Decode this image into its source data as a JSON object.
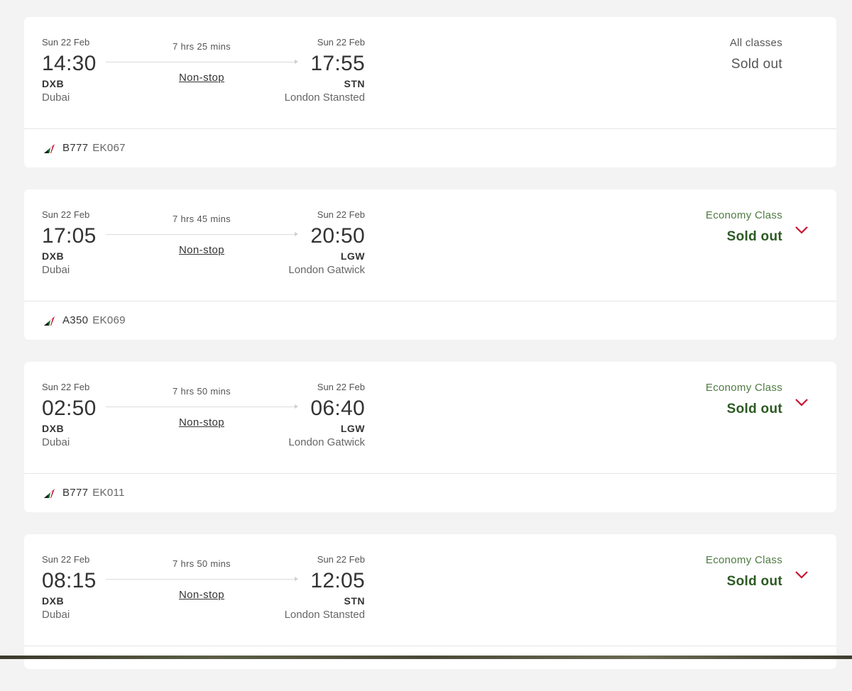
{
  "flights": [
    {
      "departure": {
        "date": "Sun 22 Feb",
        "time": "14:30",
        "code": "DXB",
        "city": "Dubai"
      },
      "duration": "7 hrs 25 mins",
      "stops": "Non-stop",
      "arrival": {
        "date": "Sun 22 Feb",
        "time": "17:55",
        "code": "STN",
        "city": "London Stansted"
      },
      "fare": {
        "class": "All classes",
        "status": "Sold out"
      },
      "aircraft": "B777",
      "flight_number": "EK067"
    },
    {
      "departure": {
        "date": "Sun 22 Feb",
        "time": "17:05",
        "code": "DXB",
        "city": "Dubai"
      },
      "duration": "7 hrs 45 mins",
      "stops": "Non-stop",
      "arrival": {
        "date": "Sun 22 Feb",
        "time": "20:50",
        "code": "LGW",
        "city": "London Gatwick"
      },
      "fare": {
        "class": "Economy Class",
        "status": "Sold out"
      },
      "aircraft": "A350",
      "flight_number": "EK069"
    },
    {
      "departure": {
        "date": "Sun 22 Feb",
        "time": "02:50",
        "code": "DXB",
        "city": "Dubai"
      },
      "duration": "7 hrs 50 mins",
      "stops": "Non-stop",
      "arrival": {
        "date": "Sun 22 Feb",
        "time": "06:40",
        "code": "LGW",
        "city": "London Gatwick"
      },
      "fare": {
        "class": "Economy Class",
        "status": "Sold out"
      },
      "aircraft": "B777",
      "flight_number": "EK011"
    },
    {
      "departure": {
        "date": "Sun 22 Feb",
        "time": "08:15",
        "code": "DXB",
        "city": "Dubai"
      },
      "duration": "7 hrs 50 mins",
      "stops": "Non-stop",
      "arrival": {
        "date": "Sun 22 Feb",
        "time": "12:05",
        "code": "STN",
        "city": "London Stansted"
      },
      "fare": {
        "class": "Economy Class",
        "status": "Sold out"
      },
      "aircraft": "",
      "flight_number": ""
    }
  ],
  "icons": {
    "airline_tail": "airline-tail-icon",
    "expand": "chevron-down-icon"
  },
  "colors": {
    "background": "#f3f3f3",
    "card": "#ffffff",
    "economy_green": "#4f7b42",
    "sold_out_green": "#2c5a22",
    "chevron_red": "#c8102e",
    "muted_text": "#555555"
  }
}
